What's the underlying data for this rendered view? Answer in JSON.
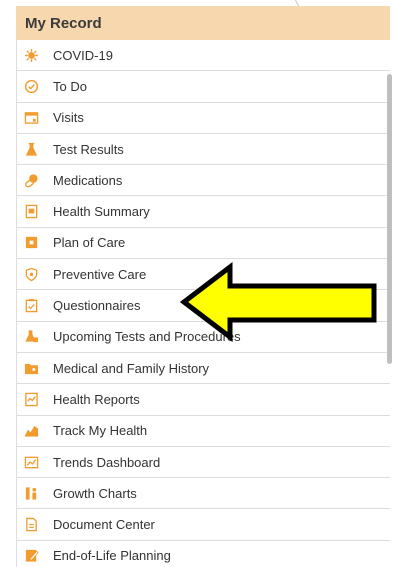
{
  "panel": {
    "title": "My Record",
    "accent_color": "#f7d7ad",
    "icon_color": "#f29b2e"
  },
  "menu": {
    "items": [
      {
        "label": "COVID-19",
        "icon": "virus-icon"
      },
      {
        "label": "To Do",
        "icon": "check-circle-icon"
      },
      {
        "label": "Visits",
        "icon": "calendar-icon"
      },
      {
        "label": "Test Results",
        "icon": "flask-icon"
      },
      {
        "label": "Medications",
        "icon": "pills-icon"
      },
      {
        "label": "Health Summary",
        "icon": "document-icon"
      },
      {
        "label": "Plan of Care",
        "icon": "plan-icon"
      },
      {
        "label": "Preventive Care",
        "icon": "shield-icon"
      },
      {
        "label": "Questionnaires",
        "icon": "clipboard-check-icon"
      },
      {
        "label": "Upcoming Tests and Procedures",
        "icon": "flask-calendar-icon"
      },
      {
        "label": "Medical and Family History",
        "icon": "folder-icon"
      },
      {
        "label": "Health Reports",
        "icon": "chart-document-icon"
      },
      {
        "label": "Track My Health",
        "icon": "bar-chart-icon"
      },
      {
        "label": "Trends Dashboard",
        "icon": "trend-line-icon"
      },
      {
        "label": "Growth Charts",
        "icon": "growth-icon"
      },
      {
        "label": "Document Center",
        "icon": "file-icon"
      },
      {
        "label": "End-of-Life Planning",
        "icon": "pen-document-icon"
      }
    ]
  },
  "annotation": {
    "arrow_color": "#ffff00",
    "points_to": "Questionnaires"
  }
}
